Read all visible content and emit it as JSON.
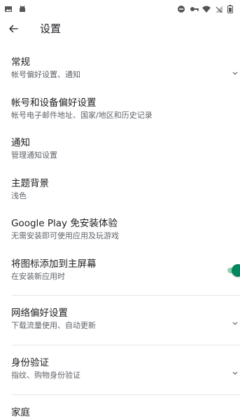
{
  "status_bar": {
    "left_icons": [
      "image-icon",
      "android-icon"
    ],
    "right_icons": [
      "minus-circle-icon",
      "key-icon",
      "wifi-icon",
      "no-signal-icon",
      "battery-icon"
    ]
  },
  "app_bar": {
    "back_icon": "arrow-left-icon",
    "title": "设置"
  },
  "items": [
    {
      "title": "常规",
      "subtitle": "帐号偏好设置、通知"
    },
    {
      "title": "帐号和设备偏好设置",
      "subtitle": "帐号电子邮件地址、国家/地区和历史记录"
    },
    {
      "title": "通知",
      "subtitle": "管理通知设置"
    },
    {
      "title": "主题背景",
      "subtitle": "浅色"
    },
    {
      "title": "Google Play 免安装体验",
      "subtitle": "无需安装即可使用应用及玩游戏"
    },
    {
      "title": "将图标添加到主屏幕",
      "subtitle": "在安装新应用时",
      "toggle": {
        "on": true
      }
    },
    {
      "title": "网络偏好设置",
      "subtitle": "下载流量使用、自动更新"
    },
    {
      "title": "身份验证",
      "subtitle": "指纹、购物身份验证"
    },
    {
      "title": "家庭",
      "subtitle": ""
    }
  ],
  "colors": {
    "accent": "#01875f",
    "text_primary": "#202124",
    "text_secondary": "#5f6368"
  }
}
